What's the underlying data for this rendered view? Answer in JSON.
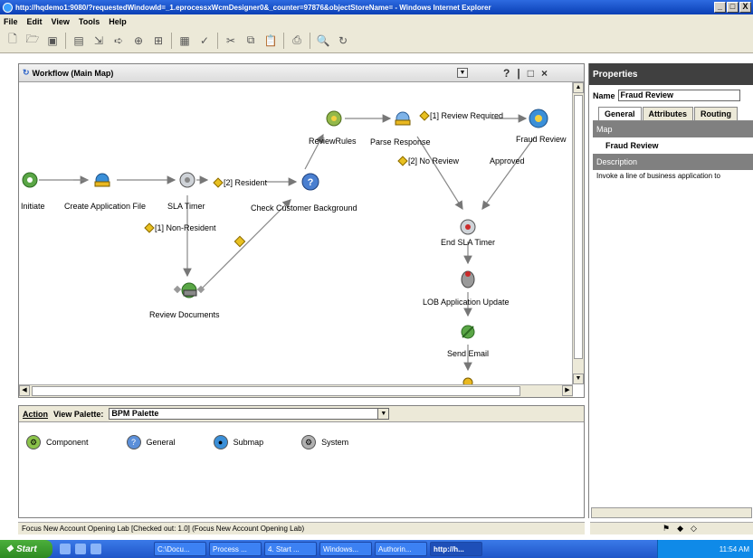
{
  "window": {
    "title": "http://hqdemo1:9080/?requestedWindowId=_1.eprocessxWcmDesigner0&_counter=97876&objectStoreName= - Windows Internet Explorer",
    "buttons": [
      "_",
      "□",
      "X"
    ]
  },
  "menu": [
    "File",
    "Edit",
    "View",
    "Tools",
    "Help"
  ],
  "workflow_panel": {
    "title": "Workflow (Main Map)",
    "nodes": [
      {
        "label": "Initiate"
      },
      {
        "label": "Create Application File"
      },
      {
        "label": "SLA Timer"
      },
      {
        "label": "Check Customer Background"
      },
      {
        "label": "ReviewRules"
      },
      {
        "label": "Parse Response"
      },
      {
        "label": "Fraud Review"
      },
      {
        "label": "End SLA Timer"
      },
      {
        "label": "Review Documents"
      },
      {
        "label": "LOB Application Update"
      },
      {
        "label": "Send Email"
      }
    ],
    "routes": {
      "resident": "[2] Resident",
      "non_resident": "[1] Non-Resident",
      "review_required": "[1] Review Required",
      "no_review": "[2] No Review",
      "approved": "Approved"
    }
  },
  "palette": {
    "action_label": "Action",
    "view_palette_label": "View Palette:",
    "selected_palette": "BPM Palette",
    "items": [
      {
        "label": "Component",
        "icon": "component-icon"
      },
      {
        "label": "General",
        "icon": "general-icon"
      },
      {
        "label": "Submap",
        "icon": "submap-icon"
      },
      {
        "label": "System",
        "icon": "system-icon"
      }
    ]
  },
  "status": "Focus New Account Opening Lab [Checked out: 1.0] (Focus New Account Opening Lab)",
  "properties": {
    "title": "Properties",
    "name_label": "Name",
    "name_value": "Fraud Review",
    "tabs": [
      "General",
      "Attributes",
      "Routing"
    ],
    "map_label": "Map",
    "map_value": "Fraud Review",
    "description_label": "Description",
    "description_value": "Invoke a line of business application to"
  },
  "taskbar": {
    "start": "Start",
    "tasks": [
      "C:\\Docu...",
      "Process ...",
      "4. Start ...",
      "Windows...",
      "Authorin...",
      "http://h..."
    ],
    "clock": "11:54 AM"
  }
}
